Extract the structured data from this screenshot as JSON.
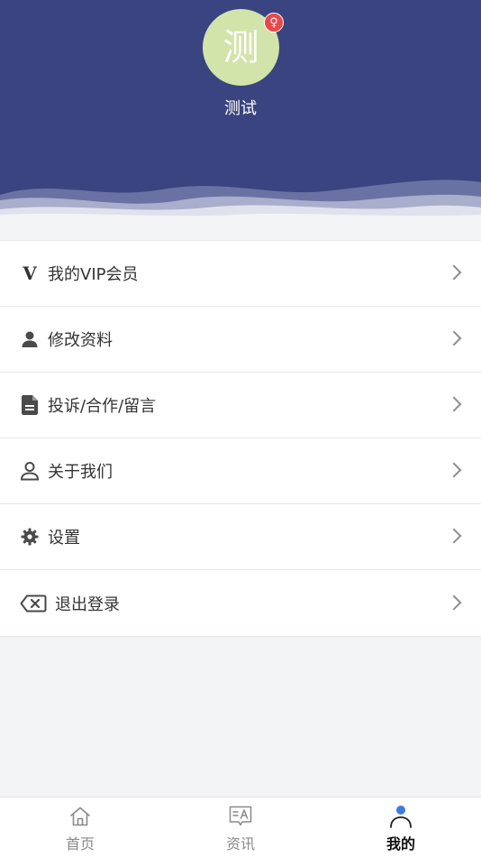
{
  "profile": {
    "avatar_char": "测",
    "avatar_color": "#d2e4a9",
    "username": "测试",
    "gender_symbol": "♀",
    "gender_badge_color": "#e8484a"
  },
  "header": {
    "background_color": "#3a4480"
  },
  "menu": {
    "items": [
      {
        "icon": "vip-v-icon",
        "icon_text": "V",
        "label": "我的VIP会员"
      },
      {
        "icon": "person-filled-icon",
        "label": "修改资料"
      },
      {
        "icon": "document-icon",
        "label": "投诉/合作/留言"
      },
      {
        "icon": "person-outline-icon",
        "label": "关于我们"
      },
      {
        "icon": "gear-icon",
        "label": "设置"
      },
      {
        "icon": "backspace-logout-icon",
        "label": "退出登录"
      }
    ]
  },
  "tabbar": {
    "tabs": [
      {
        "icon": "home-icon",
        "label": "首页",
        "active": false
      },
      {
        "icon": "news-icon",
        "label": "资讯",
        "active": false
      },
      {
        "icon": "profile-icon",
        "label": "我的",
        "active": true
      }
    ],
    "active_accent": "#3b7be0"
  }
}
